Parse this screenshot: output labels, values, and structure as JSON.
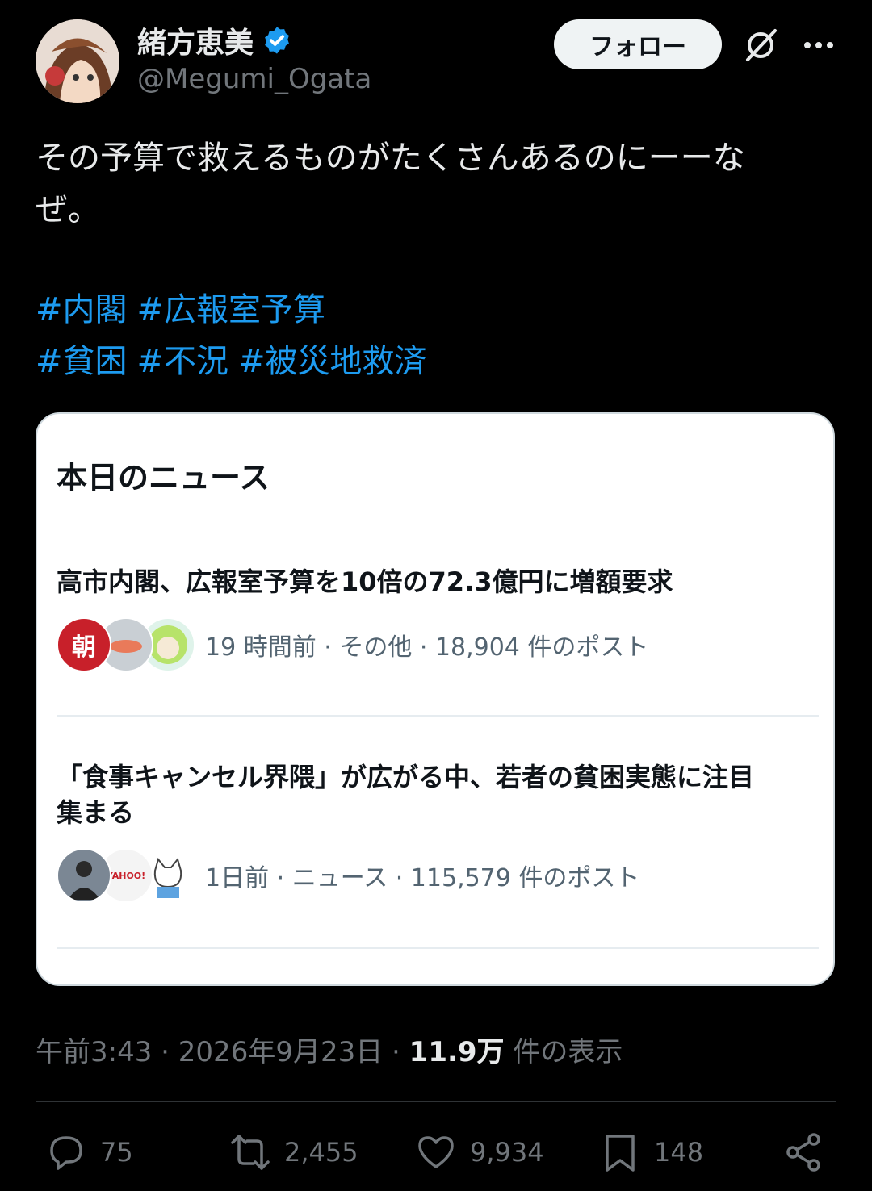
{
  "header": {
    "display_name": "緒方恵美",
    "handle": "@Megumi_Ogata",
    "follow_label": "フォロー",
    "verified": true
  },
  "tweet": {
    "text_lines": [
      "その予算で救えるものがたくさんあるのにーーな",
      "ぜ。"
    ],
    "hashtag_rows": [
      [
        "#内閣",
        "#広報室予算"
      ],
      [
        "#貧困",
        "#不況",
        "#被災地救済"
      ]
    ]
  },
  "news_card": {
    "title": "本日のニュース",
    "items": [
      {
        "headline": "高市内閣、広報室予算を10倍の72.3億円に増額要求",
        "meta": "19 時間前 · その他 · 18,904 件のポスト",
        "avatar_glyph": "朝"
      },
      {
        "headline_lines": [
          "「食事キャンセル界隈」が広がる中、若者の貧困実態に注目",
          "集まる"
        ],
        "meta": "1日前 · ニュース · 115,579 件のポスト",
        "avatar_glyph": "YAHOO!"
      }
    ]
  },
  "footer": {
    "time": "午前3:43",
    "date": "2026年9月23日",
    "views": "11.9万",
    "views_suffix": "件の表示"
  },
  "actions": {
    "replies": "75",
    "reposts": "2,455",
    "likes": "9,934",
    "bookmarks": "148"
  },
  "colors": {
    "background": "#000000",
    "link": "#1d9bf0",
    "verified": "#1d9bf0",
    "muted": "#71767b"
  }
}
